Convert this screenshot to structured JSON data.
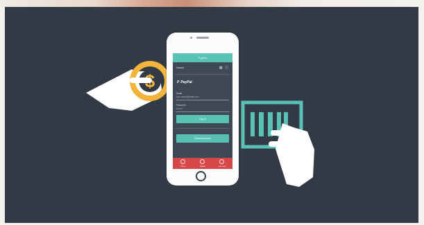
{
  "colors": {
    "background": "#313a45",
    "accent": "#58c2b5",
    "coin": "#f2b43a",
    "tab_bar": "#d6474a",
    "hand": "#ffffff"
  },
  "phone": {
    "app_header_title": "PayPal",
    "nav": {
      "left_label": "Cancel",
      "icons": [
        "grid-icon",
        "info-icon"
      ]
    },
    "brand": "PayPal",
    "fields": {
      "email_label": "Email",
      "email_value": "user.name@email.com",
      "password_label": "Password",
      "password_value": "••••••••"
    },
    "login_button_label": "Log In",
    "create_account_button_label": "Create Account",
    "tabs": [
      {
        "label": "Shop",
        "icon": "shop-icon"
      },
      {
        "label": "Wallet",
        "icon": "wallet-icon"
      },
      {
        "label": "Account",
        "icon": "account-icon"
      }
    ]
  },
  "coin_symbol": "$"
}
